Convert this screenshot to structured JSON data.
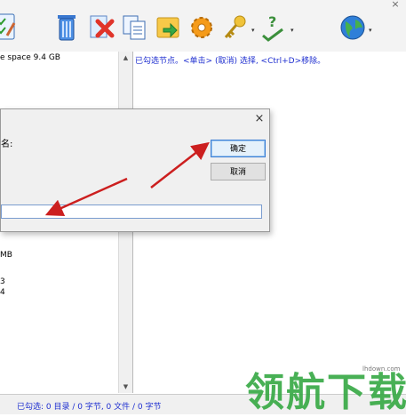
{
  "toolbar": {
    "icons": [
      "checklist-icon",
      "trash-icon",
      "delete-file-icon",
      "copy-icon",
      "move-folder-icon",
      "gear-icon",
      "key-icon",
      "help-icon",
      "globe-icon"
    ]
  },
  "left_pane": {
    "free_space": "e space 9.4 GB",
    "size1": "MB",
    "line_b": "3",
    "line_c": "4"
  },
  "right_pane": {
    "hint": "已勾选节点。<单击> (取消) 选择, <Ctrl+D>移除。"
  },
  "dialog": {
    "label": "名:",
    "ok_label": "确定",
    "cancel_label": "取消",
    "name_value": "",
    "close_glyph": "×"
  },
  "status": {
    "text": "已勾选:  0 目录 / 0  字节, 0 文件 / 0  字节"
  },
  "watermark": {
    "logo": "领航下载",
    "url": "lhdown.com"
  },
  "colors": {
    "hint_blue": "#1f2fd0",
    "arrow_red": "#cc1f1f"
  }
}
